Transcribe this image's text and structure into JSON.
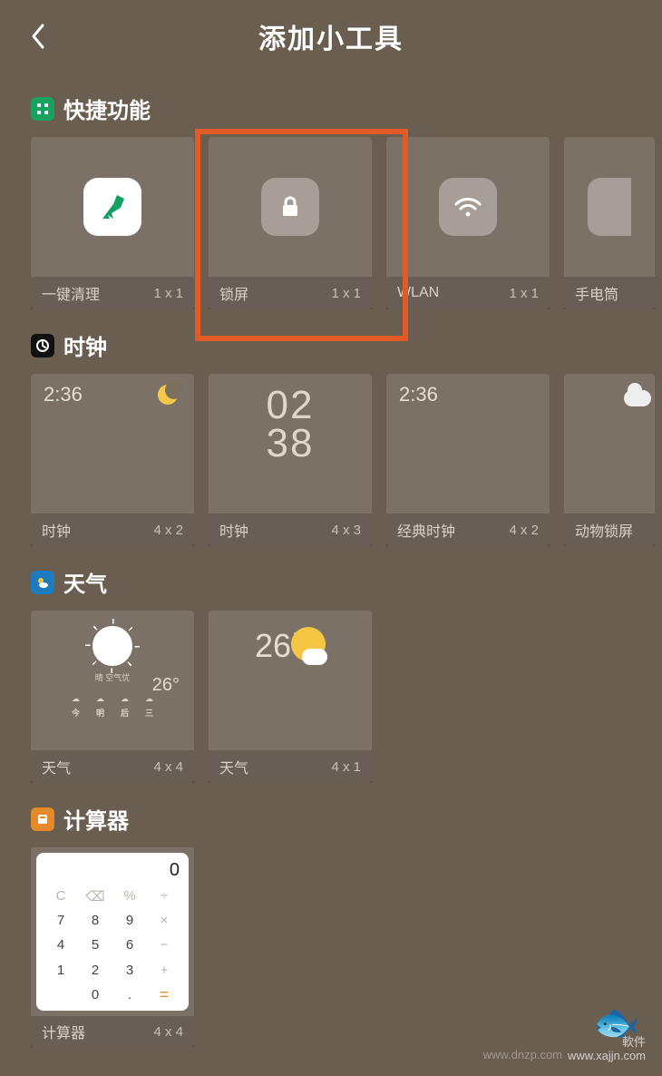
{
  "header": {
    "title": "添加小工具"
  },
  "sections": {
    "quick": {
      "icon": "grid-icon",
      "title": "快捷功能",
      "items": [
        {
          "label": "一键清理",
          "dim": "1 x 1",
          "icon": "broom-icon",
          "icon_color": "#12a060"
        },
        {
          "label": "锁屏",
          "dim": "1 x 1",
          "icon": "lock-icon"
        },
        {
          "label": "WLAN",
          "dim": "1 x 1",
          "icon": "wifi-icon"
        },
        {
          "label": "手电筒",
          "dim": "",
          "icon": "flashlight-icon"
        }
      ]
    },
    "clock": {
      "icon": "clock-icon",
      "title": "时钟",
      "items": [
        {
          "label": "时钟",
          "dim": "4 x 2",
          "time": "2:36"
        },
        {
          "label": "时钟",
          "dim": "4 x 3",
          "big_top": "02",
          "big_bot": "38"
        },
        {
          "label": "经典时钟",
          "dim": "4 x 2",
          "time": "2:36"
        },
        {
          "label": "动物锁屏",
          "dim": ""
        }
      ]
    },
    "weather": {
      "icon": "weather-icon",
      "title": "天气",
      "items": [
        {
          "label": "天气",
          "dim": "4 x 4",
          "temp": "26°",
          "forecast_days": [
            "今",
            "明",
            "后",
            "三"
          ]
        },
        {
          "label": "天气",
          "dim": "4 x 1",
          "temp": "26",
          "unit": "℃"
        }
      ]
    },
    "calc": {
      "icon": "calc-icon",
      "title": "计算器",
      "items": [
        {
          "label": "计算器",
          "dim": "4 x 4",
          "display": "0",
          "keys": [
            "C",
            "⌫",
            "%",
            "÷",
            "7",
            "8",
            "9",
            "×",
            "4",
            "5",
            "6",
            "−",
            "1",
            "2",
            "3",
            "+",
            "",
            "0",
            ".",
            "="
          ]
        }
      ]
    }
  },
  "watermarks": {
    "site1": "www.dnzp.com",
    "site2": "軟件",
    "site3": "www.xajjn.com"
  }
}
